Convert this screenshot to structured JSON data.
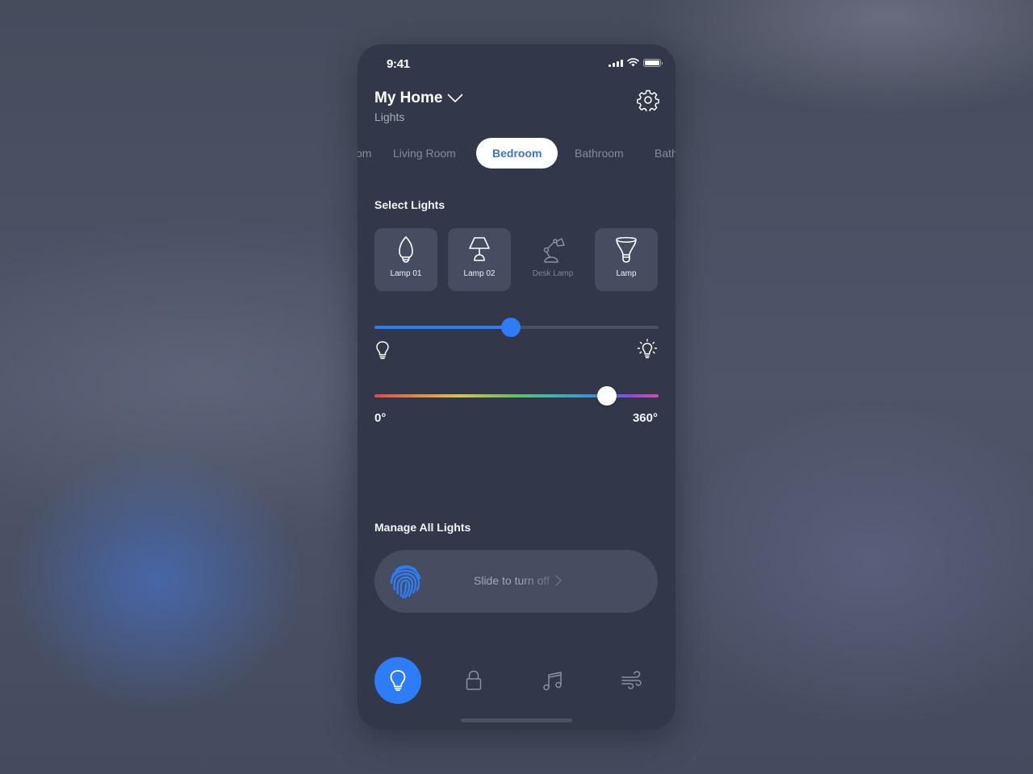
{
  "status_bar": {
    "time": "9:41",
    "icons": [
      "signal-icon",
      "wifi-icon",
      "battery-icon"
    ]
  },
  "header": {
    "title": "My Home",
    "subtitle": "Lights",
    "dropdown_icon": "chevron-down-icon",
    "settings_icon": "gear-icon"
  },
  "rooms": {
    "tabs": [
      {
        "label": "Room",
        "visible_label": "om",
        "active": false
      },
      {
        "label": "Living Room",
        "active": false
      },
      {
        "label": "Bedroom",
        "active": true
      },
      {
        "label": "Bathroom",
        "active": false
      },
      {
        "label": "Bathroom",
        "visible_label": "Bath",
        "active": false
      }
    ]
  },
  "select_lights": {
    "title": "Select Lights",
    "items": [
      {
        "label": "Lamp 01",
        "icon": "candle-bulb-icon",
        "selected": true
      },
      {
        "label": "Lamp 02",
        "icon": "table-lamp-icon",
        "selected": true
      },
      {
        "label": "Desk Lamp",
        "icon": "desk-lamp-icon",
        "selected": false
      },
      {
        "label": "Lamp",
        "icon": "spot-bulb-icon",
        "selected": true
      }
    ]
  },
  "brightness": {
    "value_percent": 48,
    "min_icon": "bulb-off-icon",
    "max_icon": "bulb-bright-icon"
  },
  "hue": {
    "value_degrees": 295,
    "min_label": "0°",
    "max_label": "360°"
  },
  "manage": {
    "title": "Manage All Lights",
    "slide_text_a": "Slide to turn ",
    "slide_text_b": "off",
    "icon": "fingerprint-icon",
    "arrow_icon": "chevron-right-icon"
  },
  "bottom_nav": {
    "items": [
      {
        "name": "lights",
        "icon": "bulb-icon",
        "active": true
      },
      {
        "name": "lock",
        "icon": "lock-icon",
        "active": false
      },
      {
        "name": "music",
        "icon": "music-note-icon",
        "active": false
      },
      {
        "name": "climate",
        "icon": "wind-icon",
        "active": false
      }
    ]
  },
  "colors": {
    "accent": "#2e7cf6",
    "phone_bg": "#323849",
    "card_bg": "#464d61",
    "active_tab_text": "#3a73c8"
  }
}
